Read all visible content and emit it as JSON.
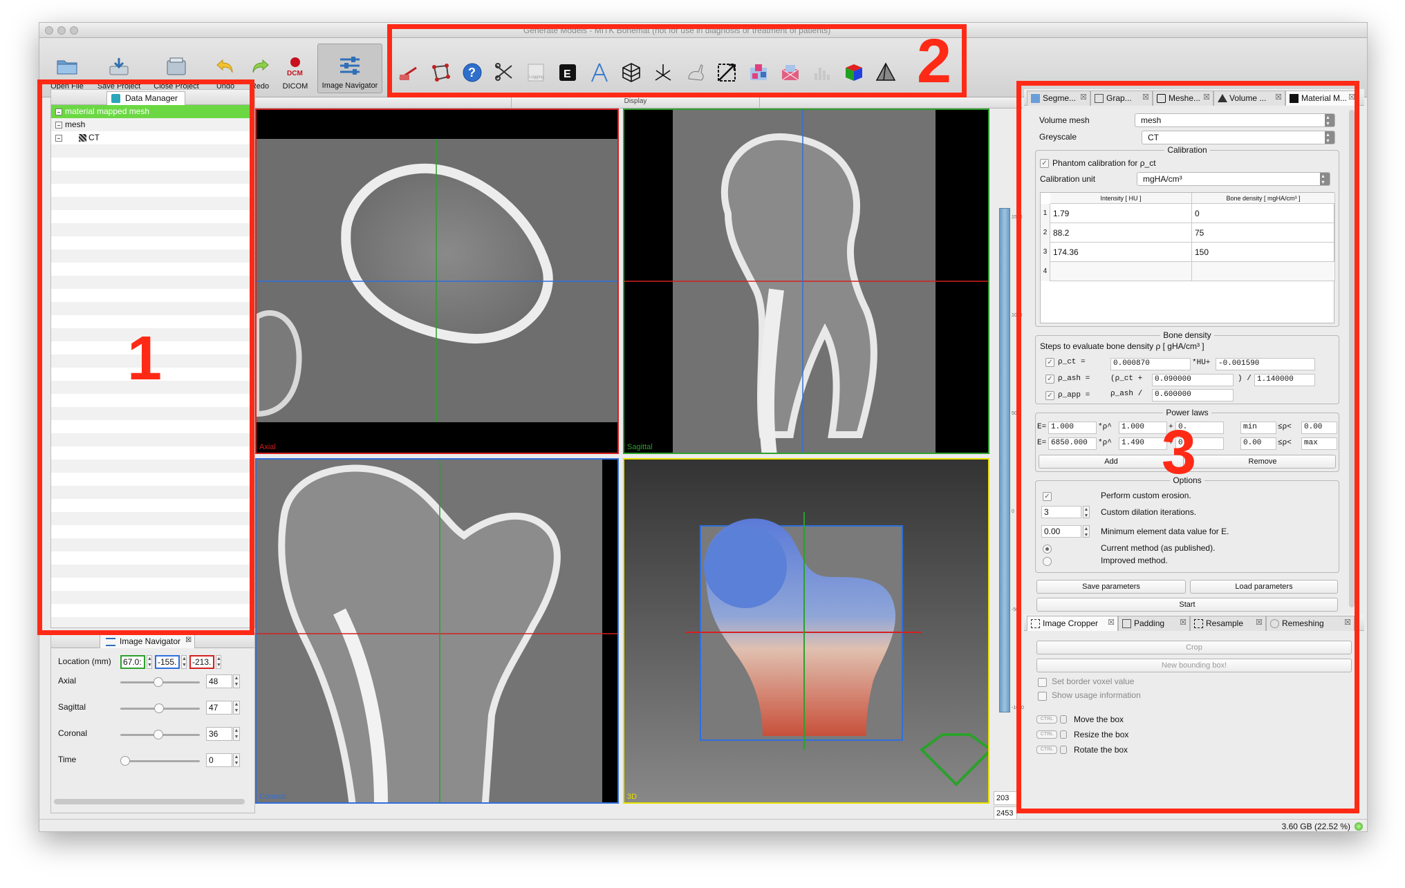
{
  "window": {
    "title": "Generate Models - MITK Bonemat (not for use in diagnosis or treatment of patients)"
  },
  "toolbar": {
    "buttons": [
      {
        "label": "Open File",
        "icon": "folder-icon"
      },
      {
        "label": "Save Project",
        "icon": "save-project-icon"
      },
      {
        "label": "Close Project",
        "icon": "close-project-icon"
      },
      {
        "label": "Undo",
        "icon": "undo-icon"
      },
      {
        "label": "Redo",
        "icon": "redo-icon"
      },
      {
        "label": "DICOM",
        "icon": "dicom-icon",
        "icon_text": "DCM"
      },
      {
        "label": "Image Navigator",
        "icon": "sliders-icon",
        "active": true
      }
    ],
    "plugin_tools": [
      "measurement-icon",
      "segmentation-icon",
      "help-icon",
      "scissors-icon",
      "logging-icon",
      "e-icon",
      "geometry-icon",
      "mesh-cube-icon",
      "axes-icon",
      "bunny-icon",
      "crop-icon",
      "pixel-grid-icon",
      "remesh-icon",
      "histogram-icon",
      "color-cube-icon",
      "pyramid-icon"
    ],
    "e_icon_text": "E",
    "logging_text": "Logging"
  },
  "annotations": {
    "n1": "1",
    "n2": "2",
    "n3": "3"
  },
  "data_manager": {
    "tab_label": "Data Manager",
    "items": [
      {
        "label": "material mapped mesh",
        "selected": true
      },
      {
        "label": "mesh",
        "selected": false
      },
      {
        "label": "CT",
        "selected": false
      }
    ]
  },
  "image_navigator": {
    "tab_label": "Image Navigator",
    "location_label": "Location (mm)",
    "location": [
      "67.0:",
      "-155.",
      "-213."
    ],
    "sliders": [
      {
        "label": "Axial",
        "value": "48",
        "fraction": 0.48
      },
      {
        "label": "Sagittal",
        "value": "47",
        "fraction": 0.49
      },
      {
        "label": "Coronal",
        "value": "36",
        "fraction": 0.48
      },
      {
        "label": "Time",
        "value": "0",
        "fraction": 0.0
      }
    ]
  },
  "display": {
    "tab_label": "Display",
    "views": {
      "axial": "Axial",
      "sagittal": "Sagittal",
      "coronal": "Coronal",
      "three_d": "3D"
    },
    "level_window": {
      "top_label": "1500",
      "bottom_label": "-1000",
      "ticks": [
        "1500",
        "1000",
        "500",
        "0",
        "-500",
        "-1000"
      ]
    },
    "level_value": "203",
    "window_value": "2453"
  },
  "right_panel": {
    "tabs": [
      "Segme...",
      "Grap...",
      "Meshe...",
      "Volume ...",
      "Material M..."
    ],
    "active_tab": "Material M...",
    "volume_mesh_label": "Volume mesh",
    "volume_mesh_value": "mesh",
    "greyscale_label": "Greyscale",
    "greyscale_value": "CT",
    "calibration": {
      "title": "Calibration",
      "phantom_label": "Phantom calibration for ρ_ct",
      "unit_label": "Calibration unit",
      "unit_value": "mgHA/cm³",
      "col1": "Intensity [ HU ]",
      "col2": "Bone density [ mgHA/cm³ ]",
      "rows": [
        {
          "n": "1",
          "hu": "1.79",
          "bd": "0"
        },
        {
          "n": "2",
          "hu": "88.2",
          "bd": "75"
        },
        {
          "n": "3",
          "hu": "174.36",
          "bd": "150"
        },
        {
          "n": "4",
          "hu": "",
          "bd": ""
        }
      ]
    },
    "bone_density": {
      "title": "Bone density",
      "steps_label": "Steps to evaluate bone density ρ [ gHA/cm³ ]",
      "rho_ct": "ρ_ct  =",
      "rho_ct_a": "0.000870",
      "rho_ct_op": "*HU+",
      "rho_ct_b": "-0.001590",
      "rho_ash": "ρ_ash =",
      "rho_ash_pre": "(ρ_ct +",
      "rho_ash_a": "0.090000",
      "rho_ash_op": ") /",
      "rho_ash_b": "1.140000",
      "rho_app": "ρ_app =",
      "rho_app_pre": "ρ_ash /",
      "rho_app_a": "0.600000"
    },
    "power_laws": {
      "title": "Power laws",
      "rows": [
        {
          "e": "E=",
          "a": "1.000",
          "op": "*ρ^",
          "b": "1.000",
          "plus": "+",
          "c": "0.",
          "min": "min",
          "rel": "≤ρ<",
          "max": "0.00"
        },
        {
          "e": "E=",
          "a": "6850.000",
          "op": "*ρ^",
          "b": "1.490",
          "plus": "+",
          "c": "0.",
          "min": "0.00",
          "rel": "≤ρ<",
          "max": "max"
        }
      ],
      "add": "Add",
      "remove": "Remove"
    },
    "options": {
      "title": "Options",
      "custom_erosion": "Perform custom erosion.",
      "dilation_value": "3",
      "dilation_label": "Custom dilation iterations.",
      "min_value": "0.00",
      "min_label": "Minimum element data value for E.",
      "method_current": "Current method (as published).",
      "method_improved": "Improved method."
    },
    "save_params": "Save parameters",
    "load_params": "Load parameters",
    "start": "Start"
  },
  "bottom_panel": {
    "tabs": [
      "Image Cropper",
      "Padding",
      "Resample",
      "Remeshing"
    ],
    "crop": "Crop",
    "new_box": "New bounding box!",
    "border_voxel": "Set border voxel value",
    "usage_info": "Show usage information",
    "kbd": "CTRL",
    "actions": [
      "Move the box",
      "Resize the box",
      "Rotate the box"
    ]
  },
  "status": {
    "memory": "3.60 GB (22.52 %)"
  },
  "colors": {
    "annotation": "#ff2a16",
    "selection": "#6bd843",
    "axial": "#d42020",
    "sagittal": "#2ca02c",
    "coronal": "#2f6fdc",
    "three_d": "#e8e000"
  }
}
